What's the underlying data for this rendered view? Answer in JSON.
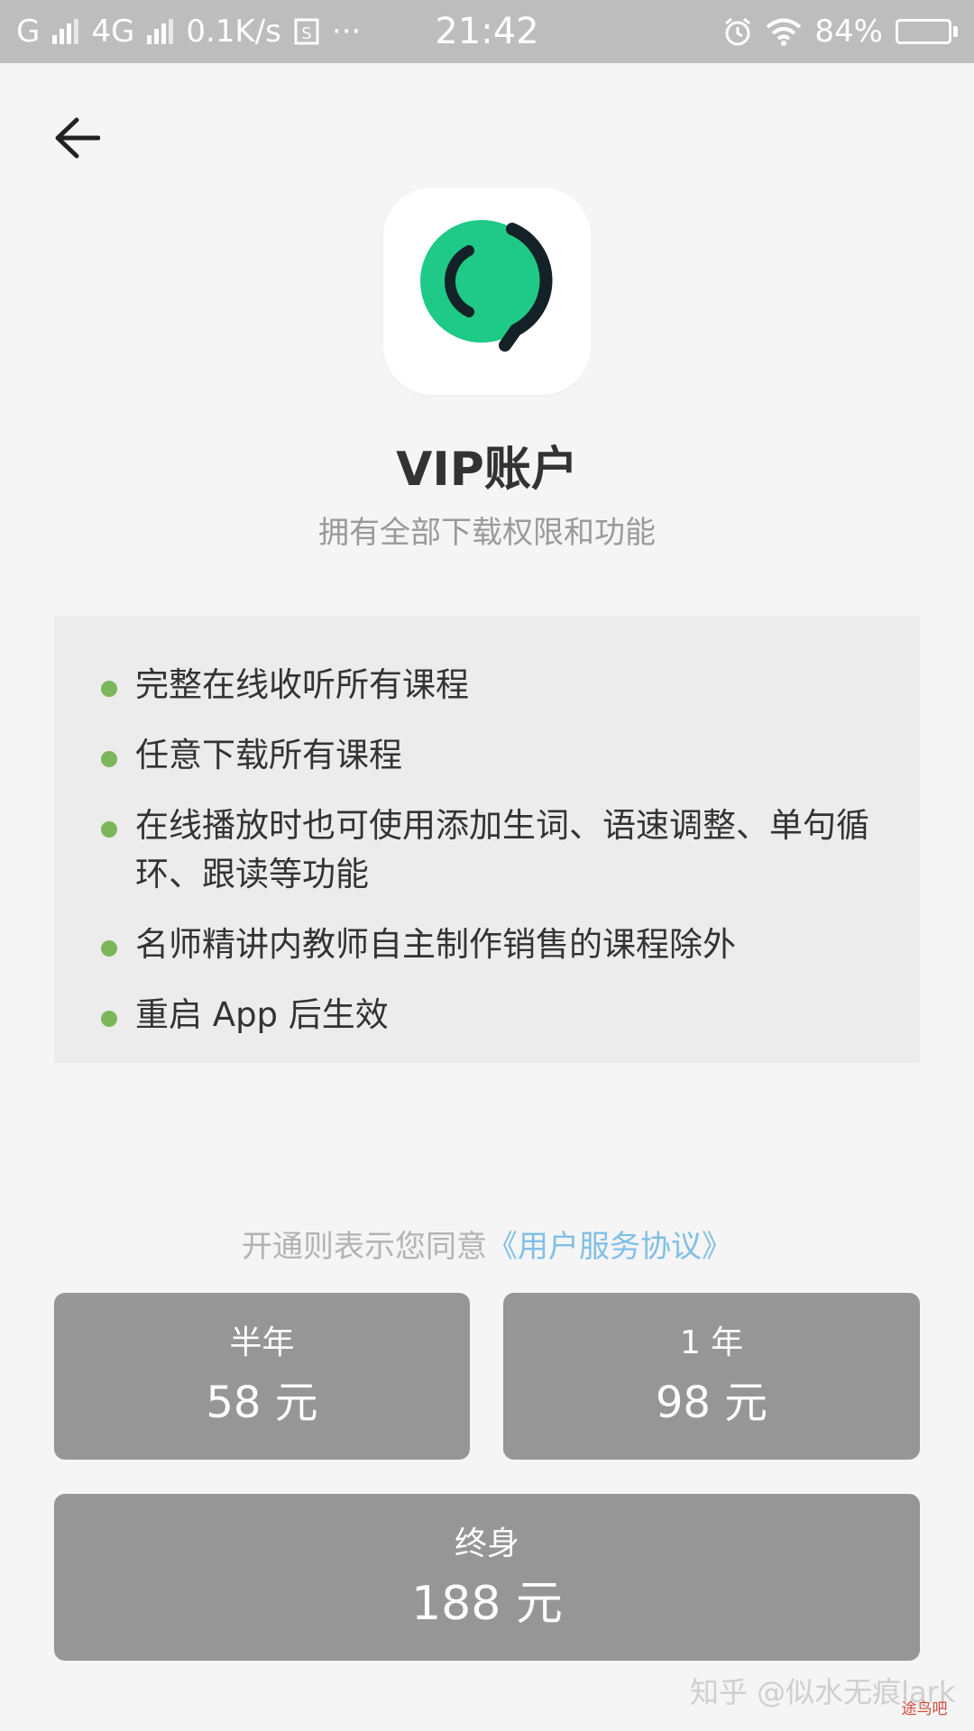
{
  "status_bar": {
    "carrier1": "G",
    "carrier2": "4G",
    "speed": "0.1K/s",
    "more": "···",
    "time": "21:42",
    "battery": "84%",
    "battery_level": 0.84
  },
  "header": {
    "title": "VIP账户",
    "subtitle": "拥有全部下载权限和功能"
  },
  "features": [
    "完整在线收听所有课程",
    "任意下载所有课程",
    "在线播放时也可使用添加生词、语速调整、单句循环、跟读等功能",
    "名师精讲内教师自主制作销售的课程除外",
    "重启 App 后生效"
  ],
  "agreement": {
    "prefix": "开通则表示您同意",
    "link": "《用户服务协议》"
  },
  "plans": [
    {
      "period": "半年",
      "price": "58 元"
    },
    {
      "period": "1 年",
      "price": "98 元"
    },
    {
      "period": "终身",
      "price": "188 元"
    }
  ],
  "watermark": {
    "text": "知乎 @似水无痕lark",
    "logo": "途鸟吧"
  },
  "colors": {
    "accent_green": "#7cb65a",
    "logo_green": "#1fc987",
    "link_blue": "#80bfe6",
    "button_gray": "#969696"
  }
}
